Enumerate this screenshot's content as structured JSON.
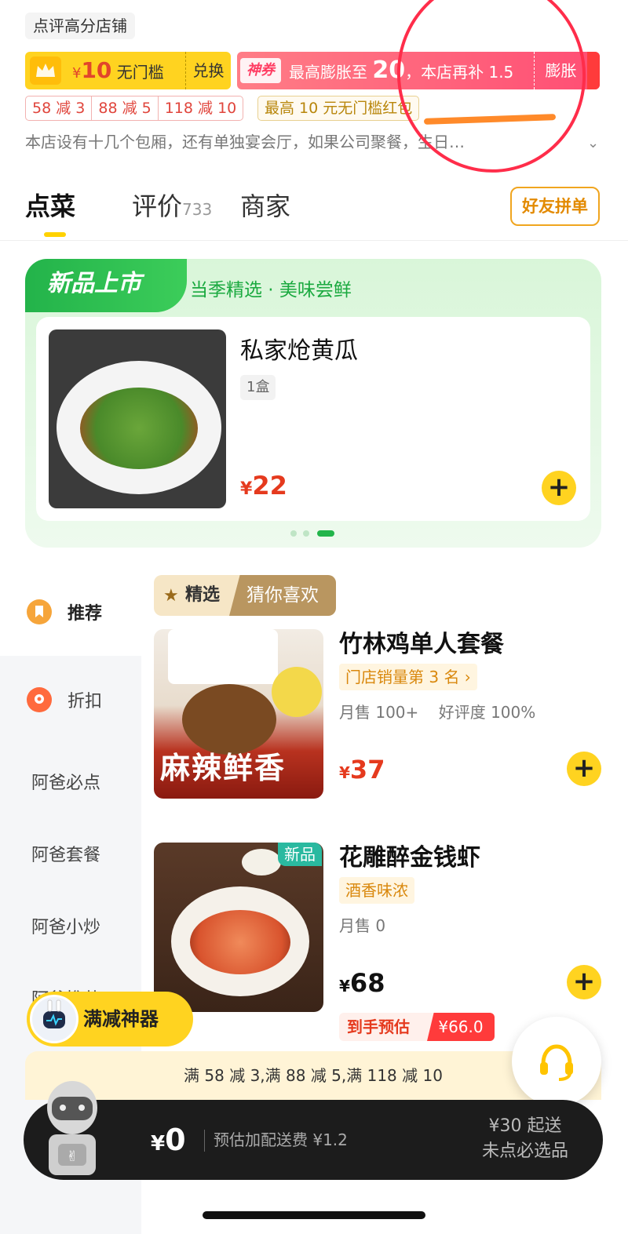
{
  "header": {
    "shop_tag": "点评高分店铺",
    "coupon_yellow": {
      "yen": "¥",
      "amount": "10",
      "label": "无门槛",
      "exchange": "兑换"
    },
    "coupon_pink": {
      "badge": "神券",
      "text_a": "最高膨胀至",
      "text_big": "20",
      "text_b": "，本店再补 1.5",
      "button": "膨胀"
    },
    "discount_tags": [
      "58 减 3",
      "88 减 5",
      "118 减 10"
    ],
    "hongbao_tag": "最高 10 元无门槛红包",
    "description": "本店设有十几个包厢，还有单独宴会厅，如果公司聚餐，生日…",
    "chevron": "⌄"
  },
  "tabs": {
    "order": "点菜",
    "reviews": "评价",
    "reviews_count": "733",
    "merchant": "商家",
    "friend_button": "好友拼单"
  },
  "new_product": {
    "badge": "新品上市",
    "subtitle": "当季精选 · 美味尝鲜",
    "name": "私家炝黄瓜",
    "unit": "1盒",
    "yen": "¥",
    "price": "22"
  },
  "sidebar": {
    "items": [
      "推荐",
      "折扣",
      "阿爸必点",
      "阿爸套餐",
      "阿爸小炒",
      "阿爸推荐"
    ]
  },
  "featured": {
    "left": "精选",
    "right": "猜你喜欢"
  },
  "products": [
    {
      "name": "竹林鸡单人套餐",
      "rank": "门店销量第 3 名 ›",
      "meta": "月售 100+    好评度 100%",
      "image_text": "麻辣鲜香",
      "yen": "¥",
      "price": "37"
    },
    {
      "name": "花雕醉金钱虾",
      "tag": "酒香味浓",
      "new_label": "新品",
      "meta": "月售 0",
      "yen": "¥",
      "price": "68",
      "estimate_label": "到手预估",
      "estimate_price": "¥66.0"
    }
  ],
  "bottom": {
    "manjian_label": "满减神器",
    "notice": "满 58 减 3,满 88 减 5,满 118 减 10",
    "cart_yen": "¥",
    "cart_amount": "0",
    "delivery_fee": "预估加配送费 ¥1.2",
    "min_order": "¥30 起送",
    "required_note": "未点必选品"
  },
  "colors": {
    "accent_yellow": "#ffd320",
    "price_red": "#e53a1e",
    "new_green": "#22b54a",
    "cart_dark": "#1c1c1c"
  }
}
